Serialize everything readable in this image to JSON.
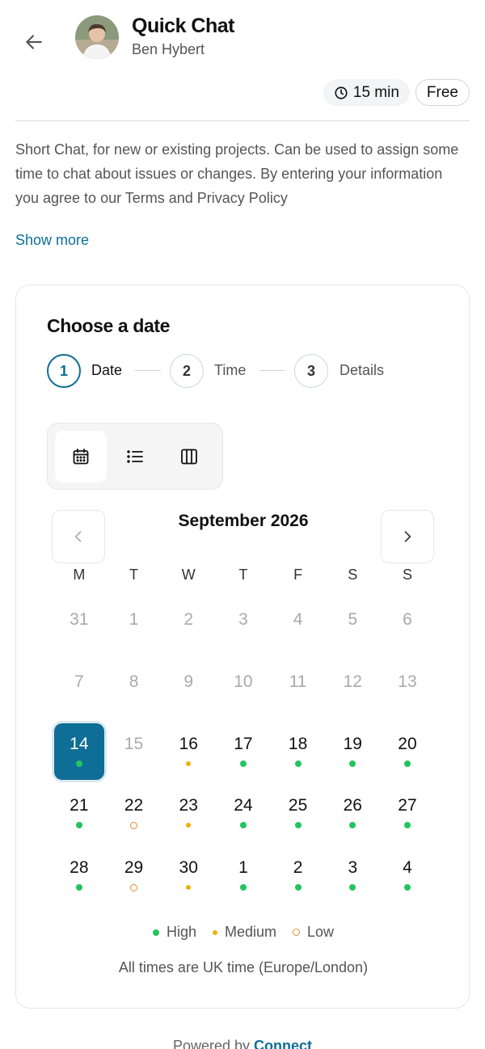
{
  "header": {
    "title": "Quick Chat",
    "host": "Ben Hybert"
  },
  "meta": {
    "duration": "15 min",
    "price": "Free"
  },
  "description": "Short Chat, for new or existing projects. Can be used to assign some time to chat about issues or changes. By entering your information you agree to our Terms and Privacy Policy",
  "show_more": "Show more",
  "booking": {
    "title": "Choose a date",
    "steps": [
      {
        "number": "1",
        "label": "Date",
        "active": true
      },
      {
        "number": "2",
        "label": "Time",
        "active": false
      },
      {
        "number": "3",
        "label": "Details",
        "active": false
      }
    ],
    "views": [
      "calendar-icon",
      "list-icon",
      "columns-icon"
    ],
    "active_view": "calendar",
    "month": "September 2026",
    "weekdays": [
      "M",
      "T",
      "W",
      "T",
      "F",
      "S",
      "S"
    ],
    "days": [
      {
        "n": "31",
        "disabled": true
      },
      {
        "n": "1",
        "disabled": true
      },
      {
        "n": "2",
        "disabled": true
      },
      {
        "n": "3",
        "disabled": true
      },
      {
        "n": "4",
        "disabled": true
      },
      {
        "n": "5",
        "disabled": true
      },
      {
        "n": "6",
        "disabled": true
      },
      {
        "n": "7",
        "disabled": true
      },
      {
        "n": "8",
        "disabled": true
      },
      {
        "n": "9",
        "disabled": true
      },
      {
        "n": "10",
        "disabled": true
      },
      {
        "n": "11",
        "disabled": true
      },
      {
        "n": "12",
        "disabled": true
      },
      {
        "n": "13",
        "disabled": true
      },
      {
        "n": "14",
        "availability": "high",
        "selected": true
      },
      {
        "n": "15",
        "disabled": true
      },
      {
        "n": "16",
        "availability": "medium"
      },
      {
        "n": "17",
        "availability": "high"
      },
      {
        "n": "18",
        "availability": "high"
      },
      {
        "n": "19",
        "availability": "high"
      },
      {
        "n": "20",
        "availability": "high"
      },
      {
        "n": "21",
        "availability": "high"
      },
      {
        "n": "22",
        "availability": "low"
      },
      {
        "n": "23",
        "availability": "medium"
      },
      {
        "n": "24",
        "availability": "high"
      },
      {
        "n": "25",
        "availability": "high"
      },
      {
        "n": "26",
        "availability": "high"
      },
      {
        "n": "27",
        "availability": "high"
      },
      {
        "n": "28",
        "availability": "high"
      },
      {
        "n": "29",
        "availability": "low"
      },
      {
        "n": "30",
        "availability": "medium"
      },
      {
        "n": "1",
        "availability": "high",
        "other_month": true
      },
      {
        "n": "2",
        "availability": "high",
        "other_month": true
      },
      {
        "n": "3",
        "availability": "high",
        "other_month": true
      },
      {
        "n": "4",
        "availability": "high",
        "other_month": true
      }
    ],
    "legend": [
      {
        "key": "high",
        "label": "High"
      },
      {
        "key": "medium",
        "label": "Medium"
      },
      {
        "key": "low",
        "label": "Low"
      }
    ],
    "timezone_note": "All times are UK time (Europe/London)"
  },
  "footer": {
    "prefix": "Powered by",
    "brand": "Connect"
  },
  "colors": {
    "accent": "#0e6e96",
    "high": "#22c55e",
    "medium": "#eab308",
    "low": "#ea8a2c"
  }
}
